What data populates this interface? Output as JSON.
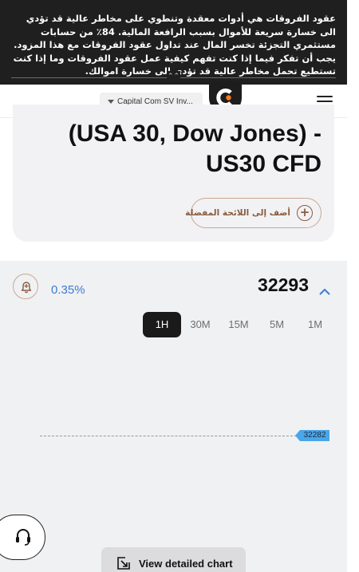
{
  "risk_warning": {
    "text": "عقود الفروقات هي أدوات معقدة وتنطوي على مخاطر عالية قد تؤدي الى خسارة سريعة للأموال بسبب الرافعة المالية. 84٪ من حسابات مستثمري التجزئة تخسر المال عند تداول عقود الفروقات مع هذا المزود. يجب أن تفكر فيما إذا كنت تفهم كيفية عمل عقود الفروقات وما إذا كنت تستطيع تحمل مخاطر عالية قد تؤدي الى خسارة اموالك.",
    "collapse_icon": "double-chevron-up-icon"
  },
  "header": {
    "entity_selector": "Capital Com SV Inv...",
    "logo_icon": "capital-com-logo",
    "menu_icon": "hamburger-menu-icon"
  },
  "hero": {
    "title": "(USA 30, Dow Jones) - US30 CFD",
    "favorite_label": "أضف إلى اللائحة المفضلة",
    "favorite_icon": "plus-circle-icon"
  },
  "quote": {
    "change": "0.35%",
    "price": "32293",
    "alert_icon": "bell-plus-icon",
    "collapse_icon": "chevron-up-icon",
    "accent_color": "#3a7bd5"
  },
  "timeframes": [
    {
      "label": "1H",
      "active": true
    },
    {
      "label": "30M",
      "active": false
    },
    {
      "label": "15M",
      "active": false
    },
    {
      "label": "5M",
      "active": false
    },
    {
      "label": "1M",
      "active": false
    }
  ],
  "chart": {
    "current_price_label": "32282"
  },
  "support": {
    "icon": "headset-icon"
  },
  "detail_chart": {
    "label": "View detailed chart",
    "icon": "expand-chart-icon"
  }
}
